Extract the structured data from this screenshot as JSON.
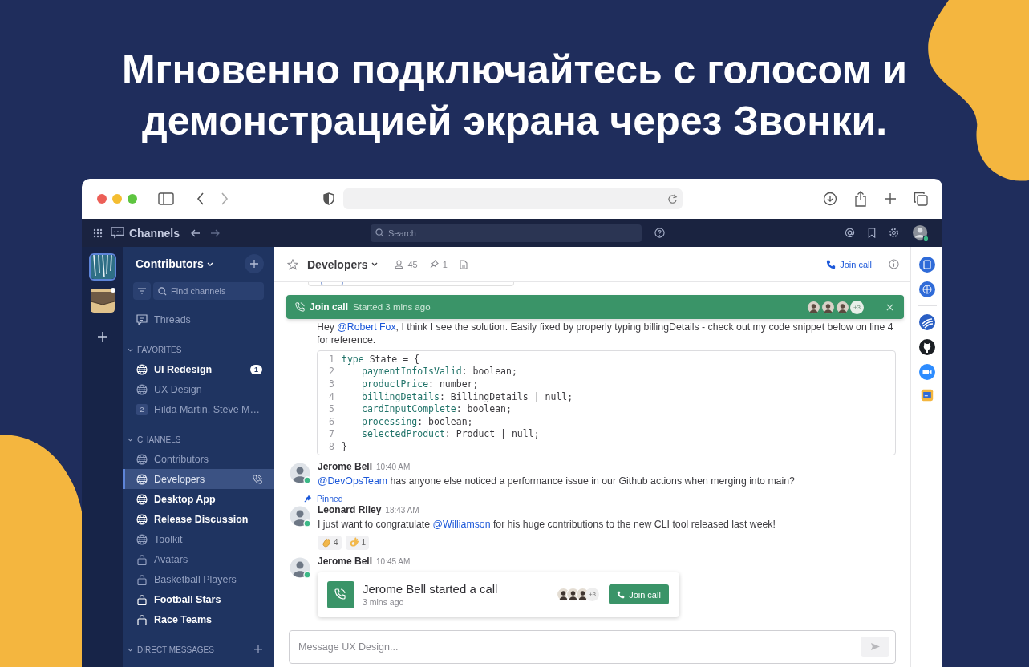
{
  "headline": "Мгновенно подключайтесь с голосом и демонстрацией экрана через Звонки.",
  "app_bar": {
    "title": "Channels",
    "search_placeholder": "Search"
  },
  "teams": [
    {
      "selected": true,
      "unread": false
    },
    {
      "selected": false,
      "unread": true
    }
  ],
  "sidebar": {
    "team_name": "Contributors",
    "filter_placeholder": "Find channels",
    "threads": "Threads",
    "sections": [
      {
        "title": "FAVORITES",
        "items": [
          {
            "label": "UI Redesign",
            "kind": "public",
            "unread": true,
            "selected": false,
            "call": false,
            "badge": "1"
          },
          {
            "label": "UX Design",
            "kind": "public",
            "unread": false,
            "selected": false,
            "call": false
          },
          {
            "label": "Hilda Martin, Steve M…",
            "kind": "dm",
            "count": "2",
            "unread": false,
            "selected": false,
            "call": false
          }
        ]
      },
      {
        "title": "CHANNELS",
        "items": [
          {
            "label": "Contributors",
            "kind": "public",
            "unread": false,
            "selected": false,
            "call": false
          },
          {
            "label": "Developers",
            "kind": "public",
            "unread": false,
            "selected": true,
            "call": true
          },
          {
            "label": "Desktop App",
            "kind": "public",
            "unread": true,
            "selected": false,
            "call": false
          },
          {
            "label": "Release Discussion",
            "kind": "public",
            "unread": true,
            "selected": false,
            "call": false
          },
          {
            "label": "Toolkit",
            "kind": "public",
            "unread": false,
            "selected": false,
            "call": false
          },
          {
            "label": "Avatars",
            "kind": "private",
            "unread": false,
            "selected": false,
            "call": false
          },
          {
            "label": "Basketball Players",
            "kind": "private",
            "unread": false,
            "selected": false,
            "call": false
          },
          {
            "label": "Football Stars",
            "kind": "private",
            "unread": true,
            "selected": false,
            "call": false
          },
          {
            "label": "Race Teams",
            "kind": "private",
            "unread": true,
            "selected": false,
            "call": false
          }
        ]
      },
      {
        "title": "DIRECT MESSAGES",
        "can_add": true
      }
    ]
  },
  "channel": {
    "name": "Developers",
    "members": "45",
    "pins": "1",
    "join_call": "Join call"
  },
  "call_banner": {
    "label": "Join call",
    "status": "Started 3 mins ago",
    "more": "+3"
  },
  "messages": [
    {
      "kind": "continuation",
      "parts": [
        {
          "text": "Hey ",
          "mention": false
        },
        {
          "text": "@Robert Fox",
          "mention": true
        },
        {
          "text": ", I think I see the solution. Easily fixed by properly typing billingDetails - check out my code snippet below on line 4 for reference.",
          "mention": false
        }
      ],
      "code": [
        {
          "n": "1",
          "kind": "keyword",
          "key": "type",
          "rest": " State = {"
        },
        {
          "n": "2",
          "kind": "field",
          "key": "paymentInfoIsValid",
          "rest": ": boolean;"
        },
        {
          "n": "3",
          "kind": "field",
          "key": "productPrice",
          "rest": ": number;"
        },
        {
          "n": "4",
          "kind": "field",
          "key": "billingDetails",
          "rest": ": BillingDetails | null;"
        },
        {
          "n": "5",
          "kind": "field",
          "key": "cardInputComplete",
          "rest": ": boolean;"
        },
        {
          "n": "6",
          "kind": "field",
          "key": "processing",
          "rest": ": boolean;"
        },
        {
          "n": "7",
          "kind": "field",
          "key": "selectedProduct",
          "rest": ": Product | null;"
        },
        {
          "n": "8",
          "kind": "plain",
          "rest": "}"
        }
      ]
    },
    {
      "kind": "message",
      "author": "Jerome Bell",
      "time": "10:40 AM",
      "pinned": false,
      "parts": [
        {
          "text": "@DevOpsTeam",
          "mention": true
        },
        {
          "text": " has anyone else noticed a performance issue in our Github actions when merging into main?",
          "mention": false
        }
      ]
    },
    {
      "kind": "message",
      "author": "Leonard Riley",
      "time": "18:43 AM",
      "pinned": true,
      "pinned_label": "Pinned",
      "parts": [
        {
          "text": "I just want to congratulate ",
          "mention": false
        },
        {
          "text": "@Williamson",
          "mention": true
        },
        {
          "text": " for his huge contributions to the new CLI tool released last week!",
          "mention": false
        }
      ],
      "reactions": [
        {
          "kind": "clap",
          "count": "4"
        },
        {
          "kind": "ok",
          "count": "1"
        }
      ]
    },
    {
      "kind": "call",
      "author": "Jerome Bell",
      "time": "10:45 AM",
      "pinned": false,
      "call": {
        "title": "Jerome Bell started a call",
        "time": "3 mins ago",
        "more": "+3",
        "button": "Join call"
      }
    }
  ],
  "composer": {
    "placeholder": "Message UX Design..."
  }
}
